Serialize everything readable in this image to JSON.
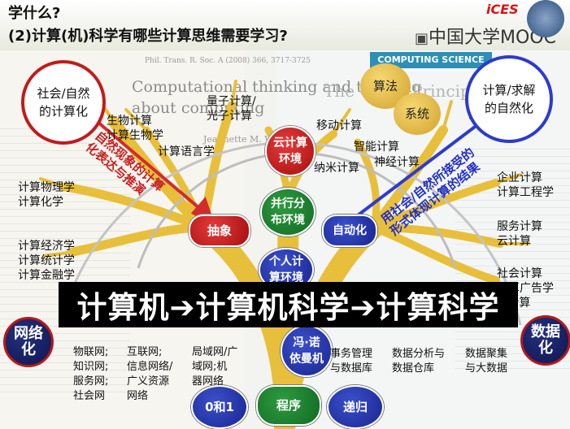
{
  "header": {
    "line1": "学什么?",
    "line2": "(2)计算(机)科学有哪些计算思维需要学习?"
  },
  "watermark": {
    "mooc": "中国大学MOOC",
    "logo_text": "iCES"
  },
  "paper": {
    "journal": "Phil. Trans. R. Soc. A (2008) 366, 3717-3725",
    "title_line1": "Computational thinking and thinking",
    "title_line2": "about computing",
    "author": "Jeannette M. Wing",
    "right_header": "COMPUTING SCIENCE",
    "right_title": "The Great Principles of..."
  },
  "corners": {
    "top_left": "社会/自然\n的计算化",
    "top_right": "计算/求解\n的自然化",
    "bottom_left": "网络\n化",
    "bottom_right": "数据\n化"
  },
  "arrows": {
    "left_text": "自然现象的计算\n化表达与推演",
    "right_text": "用社会/自然所接受的\n形式体现计算的结果"
  },
  "nodes": {
    "cloud": "云计算\n环境",
    "parallel": "并行分\n布环境",
    "personal": "个人计\n算环境",
    "vonneumann": "冯·诺\n依曼机",
    "abstraction": "抽象",
    "automation": "自动化",
    "algorithm": "算法",
    "system": "系统",
    "zero_one": "0和1",
    "program": "程序",
    "recursion": "递归"
  },
  "labels": {
    "biocomp": "生物计算\n计算生物学",
    "quantum": "量子计算/\n光子计算",
    "complang": "计算语言学",
    "physics": "计算物理学\n计算化学",
    "econ": "计算经济学\n计算统计学\n计算金融学",
    "mobile": "移动计算",
    "smart": "智能计算",
    "neural": "神经计算",
    "nano": "纳米计算",
    "enterprise": "企业计算\n计算工程学",
    "service": "服务计算\n云计算",
    "social": "社会计算\n计算广告学\n...计算",
    "networks_col1": "物联网;\n知识网;\n服务网;\n社会网",
    "networks_col2": "互联网;\n信息网络/\n广义资源\n网络",
    "networks_col3": "局域网/广\n域网;机\n器网络",
    "transaction": "事务管理\n与数据库",
    "analysis": "数据分析与\n数据仓库",
    "aggregation": "数据聚集\n与大数据"
  },
  "banner": "计算机➔计算机科学➔计算科学",
  "colors": {
    "red_node": "#b71717",
    "green_node": "#12702a",
    "blue_node": "#1f2c99",
    "navy_node": "#15205f",
    "tree_branch": "#e8bf3a",
    "arrow_red": "#d22b2b",
    "arrow_blue": "#2d3bd2",
    "banner_bg": "#000000"
  },
  "icons": [
    "tree-diagram",
    "red-arrow",
    "blue-arrow",
    "logo-badge"
  ]
}
